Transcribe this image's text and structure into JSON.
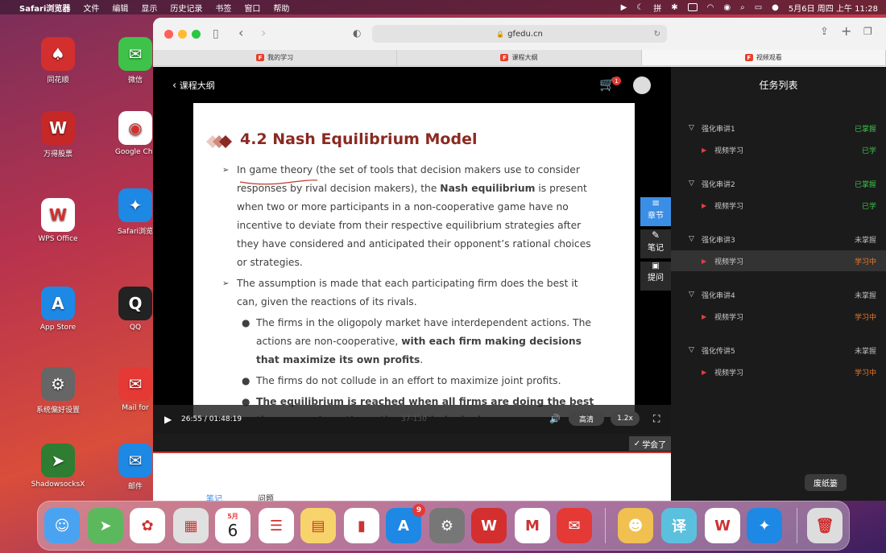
{
  "menubar": {
    "apple": "",
    "app_name": "Safari浏览器",
    "items": [
      "文件",
      "编辑",
      "显示",
      "历史记录",
      "书签",
      "窗口",
      "帮助"
    ],
    "clock": "5月6日 周四 上午 11:28"
  },
  "desktop_icons": [
    {
      "label": "同花顺",
      "color": "#d32f2f",
      "glyph": "♠"
    },
    {
      "label": "微信",
      "color": "#3fc24a",
      "glyph": "✉"
    },
    {
      "label": "万得股票",
      "color": "#c62828",
      "glyph": "W"
    },
    {
      "label": "Google Chr",
      "color": "#ffffff",
      "glyph": "◉"
    },
    {
      "label": "Safari浏览",
      "color": "#1e88e5",
      "glyph": "✦"
    },
    {
      "label": "WPS Office",
      "color": "#ffffff",
      "glyph": "W"
    },
    {
      "label": "App Store",
      "color": "#1e88e5",
      "glyph": "A"
    },
    {
      "label": "QQ",
      "color": "#222222",
      "glyph": "Q"
    },
    {
      "label": "系统偏好设置",
      "color": "#666666",
      "glyph": "⚙"
    },
    {
      "label": "Mail for",
      "color": "#e53935",
      "glyph": "✉"
    },
    {
      "label": "ShadowsocksX",
      "color": "#2e7d32",
      "glyph": "➤"
    },
    {
      "label": "邮件",
      "color": "#1e88e5",
      "glyph": "✉"
    }
  ],
  "browser": {
    "url": "gfedu.cn",
    "tabs": [
      {
        "label": "我的学习",
        "active": false
      },
      {
        "label": "课程大纲",
        "active": false
      },
      {
        "label": "视频观看",
        "active": true
      }
    ]
  },
  "player": {
    "back_label": "课程大纲",
    "cart_badge": "1",
    "slide_title": "4.2 Nash Equilibrium Model",
    "slide_items": [
      {
        "level": 1,
        "segments": [
          {
            "t": "In game theory (the set of tools that decision makers use to consider responses by rival decision makers), the ",
            "b": false
          },
          {
            "t": "Nash equilibrium",
            "b": true
          },
          {
            "t": " is present when two or more participants in a non-cooperative game have no incentive to deviate from their respective equilibrium strategies after they have considered and anticipated their opponent’s rational choices or strategies.",
            "b": false
          }
        ]
      },
      {
        "level": 1,
        "segments": [
          {
            "t": "The assumption is made that each participating firm does the best it can, given the reactions of its rivals.",
            "b": false
          }
        ]
      },
      {
        "level": 2,
        "segments": [
          {
            "t": "The firms in the oligopoly market have interdependent actions. The actions are non-cooperative, ",
            "b": false
          },
          {
            "t": "with each firm making decisions that maximize its own profits",
            "b": true
          },
          {
            "t": ".",
            "b": false
          }
        ]
      },
      {
        "level": 2,
        "segments": [
          {
            "t": "The firms do not collude in an effort to maximize joint profits.",
            "b": false
          }
        ]
      },
      {
        "level": 2,
        "segments": [
          {
            "t": "The equilibrium is reached when all firms are doing the best they can, given the actions of their rivals.",
            "b": true
          }
        ]
      }
    ],
    "page_number": "37-130",
    "time": "26:55 / 01:48:19",
    "quality": "高清",
    "speed": "1.2x",
    "learned_label": "学会了",
    "side_buttons": [
      {
        "label": "章节",
        "icon": "list-icon",
        "glyph": "≡"
      },
      {
        "label": "笔记",
        "icon": "pencil-icon",
        "glyph": "✎"
      },
      {
        "label": "提问",
        "icon": "question-icon",
        "glyph": "▣"
      }
    ],
    "below_tabs": [
      "笔记",
      "问题"
    ]
  },
  "tasks": {
    "title": "任务列表",
    "chapters": [
      {
        "name": "强化串讲1",
        "status": "已掌握",
        "status_color": "#3ec24a",
        "video": "视频学习",
        "video_status": "已学",
        "video_color": "#3ec24a",
        "active": false
      },
      {
        "name": "强化串讲2",
        "status": "已掌握",
        "status_color": "#3ec24a",
        "video": "视频学习",
        "video_status": "已学",
        "video_color": "#3ec24a",
        "active": false
      },
      {
        "name": "强化串讲3",
        "status": "未掌握",
        "status_color": "#bbbbbb",
        "video": "视频学习",
        "video_status": "学习中",
        "video_color": "#f07a2a",
        "active": true
      },
      {
        "name": "强化串讲4",
        "status": "未掌握",
        "status_color": "#bbbbbb",
        "video": "视频学习",
        "video_status": "学习中",
        "video_color": "#f07a2a",
        "active": false
      },
      {
        "name": "强化传讲5",
        "status": "未掌握",
        "status_color": "#bbbbbb",
        "video": "视频学习",
        "video_status": "学习中",
        "video_color": "#f07a2a",
        "active": false
      }
    ]
  },
  "dock": {
    "trash_tooltip": "废纸篓",
    "calendar_month": "5月",
    "calendar_day": "6",
    "appstore_badge": "9",
    "apps": [
      {
        "name": "finder",
        "color": "#4aa3f0",
        "glyph": "☺"
      },
      {
        "name": "maps",
        "color": "#5cb85c",
        "glyph": "➤"
      },
      {
        "name": "photos",
        "color": "#ffffff",
        "glyph": "✿"
      },
      {
        "name": "launchpad",
        "color": "#e0e0e0",
        "glyph": "▦"
      },
      {
        "name": "calendar",
        "color": "#ffffff",
        "glyph": ""
      },
      {
        "name": "reminders",
        "color": "#ffffff",
        "glyph": "☰"
      },
      {
        "name": "notes",
        "color": "#f7d36b",
        "glyph": "▤"
      },
      {
        "name": "numbers",
        "color": "#ffffff",
        "glyph": "▮"
      },
      {
        "name": "app-store",
        "color": "#1e88e5",
        "glyph": "A"
      },
      {
        "name": "system-preferences",
        "color": "#777777",
        "glyph": "⚙"
      },
      {
        "name": "wind",
        "color": "#d32f2f",
        "glyph": "W"
      },
      {
        "name": "app-m",
        "color": "#ffffff",
        "glyph": "M"
      },
      {
        "name": "mail-app",
        "color": "#e53935",
        "glyph": "✉"
      },
      {
        "name": "family-app",
        "color": "#f0c050",
        "glyph": "☻"
      },
      {
        "name": "translate",
        "color": "#5bc0de",
        "glyph": "译"
      },
      {
        "name": "wps",
        "color": "#ffffff",
        "glyph": "W"
      },
      {
        "name": "safari",
        "color": "#1e88e5",
        "glyph": "✦"
      },
      {
        "name": "trash",
        "color": "#dddddd",
        "glyph": "🗑"
      }
    ]
  }
}
